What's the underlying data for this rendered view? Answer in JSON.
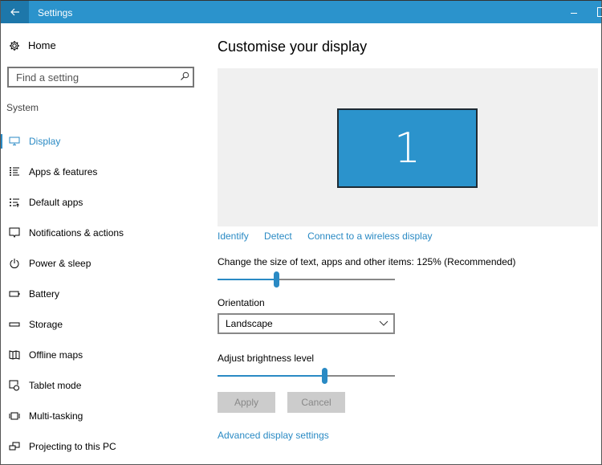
{
  "window": {
    "title": "Settings",
    "titlebar_color": "#2b93cc",
    "accent_color": "#2a8ac4"
  },
  "sidebar": {
    "home_label": "Home",
    "search_placeholder": "Find a setting",
    "section_label": "System",
    "items": [
      {
        "label": "Display",
        "icon": "monitor-icon",
        "active": true
      },
      {
        "label": "Apps & features",
        "icon": "list-icon",
        "active": false
      },
      {
        "label": "Default apps",
        "icon": "default-apps-icon",
        "active": false
      },
      {
        "label": "Notifications & actions",
        "icon": "notification-icon",
        "active": false
      },
      {
        "label": "Power & sleep",
        "icon": "power-icon",
        "active": false
      },
      {
        "label": "Battery",
        "icon": "battery-icon",
        "active": false
      },
      {
        "label": "Storage",
        "icon": "storage-icon",
        "active": false
      },
      {
        "label": "Offline maps",
        "icon": "map-icon",
        "active": false
      },
      {
        "label": "Tablet mode",
        "icon": "tablet-mode-icon",
        "active": false
      },
      {
        "label": "Multi-tasking",
        "icon": "multitasking-icon",
        "active": false
      },
      {
        "label": "Projecting to this PC",
        "icon": "projecting-icon",
        "active": false
      }
    ]
  },
  "main": {
    "title": "Customise your display",
    "monitor_number": "1",
    "links": {
      "identify": "Identify",
      "detect": "Detect",
      "wireless": "Connect to a wireless display"
    },
    "scale": {
      "label": "Change the size of text, apps and other items: 125% (Recommended)",
      "value_fraction": 0.33
    },
    "orientation": {
      "label": "Orientation",
      "selected": "Landscape"
    },
    "brightness": {
      "label": "Adjust brightness level",
      "value_fraction": 0.6
    },
    "buttons": {
      "apply": "Apply",
      "cancel": "Cancel"
    },
    "advanced_link": "Advanced display settings"
  }
}
